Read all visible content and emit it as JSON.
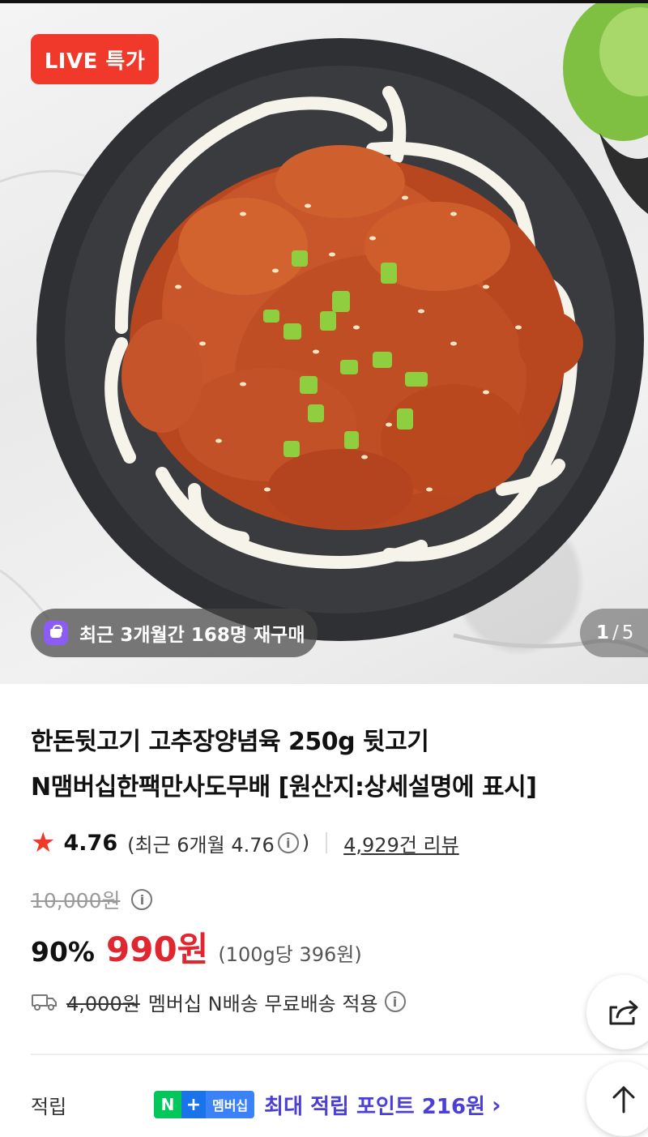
{
  "hero": {
    "badge": "LIVE 특가",
    "repurchase_text": "최근 3개월간 168명 재구매",
    "page_current": "1",
    "page_separator": "/",
    "page_total": "5"
  },
  "product": {
    "title_line1": "한돈뒷고기 고추장양념육 250g 뒷고기",
    "title_line2": "N맴버십한팩만사도무배 [원산지:상세설명에 표시]",
    "rating": "4.76",
    "rating_recent_prefix": "(최근 6개월 4.76",
    "rating_recent_suffix": ")",
    "review_count": "4,929건 리뷰",
    "original_price": "10,000원",
    "discount_rate": "90%",
    "sale_price": "990원",
    "unit_price": "(100g당 396원)",
    "shipping_original": "4,000원",
    "shipping_text": "멤버십 N배송 무료배송 적용"
  },
  "points": {
    "label": "적립",
    "badge_n": "N",
    "badge_plus": "+",
    "badge_member": "멤버십",
    "text": "최대 적립 포인트 216원",
    "chevron": "›"
  },
  "icons": {
    "star": "★",
    "info": "i"
  },
  "colors": {
    "live_red": "#f0392b",
    "price_red": "#e0262e",
    "points_purple": "#4b3fd8",
    "naver_green": "#03c75a"
  }
}
